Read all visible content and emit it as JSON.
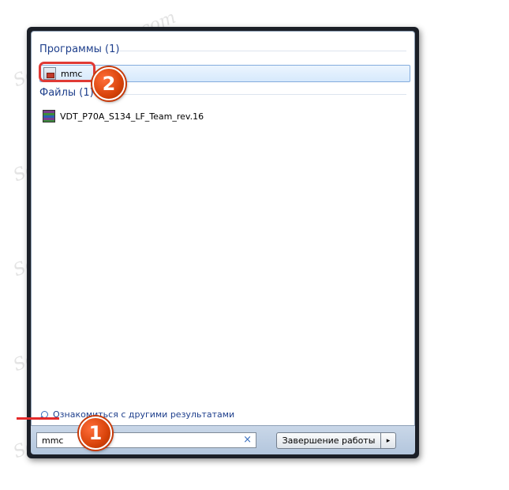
{
  "results": {
    "programs_header": "Программы (1)",
    "program_item": "mmc",
    "files_header": "Файлы (1)",
    "file_item": "VDT_P70A_S134_LF_Team_rev.16"
  },
  "more_results_link": "Ознакомиться с другими результатами",
  "search": {
    "value": "mmc",
    "clear_glyph": "×"
  },
  "shutdown": {
    "label": "Завершение работы",
    "arrow_glyph": "▸"
  },
  "annotations": {
    "step1": "1",
    "step2": "2"
  },
  "watermark_text": "Soringpcrepair.com",
  "colors": {
    "accent_red": "#e03a35",
    "badge_orange": "#d8430a",
    "link_blue": "#1e3f8c"
  }
}
